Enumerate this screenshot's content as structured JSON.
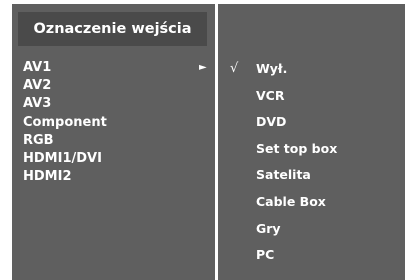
{
  "left_panel": {
    "title": "Oznaczenie wejścia",
    "inputs": [
      {
        "label": "AV1",
        "arrow": "►"
      },
      {
        "label": "AV2"
      },
      {
        "label": "AV3"
      },
      {
        "label": "Component"
      },
      {
        "label": "RGB"
      },
      {
        "label": "HDMI1/DVI"
      },
      {
        "label": "HDMI2"
      }
    ]
  },
  "right_panel": {
    "check_mark": "√",
    "options": [
      {
        "label": "Wył.",
        "selected": true
      },
      {
        "label": "VCR"
      },
      {
        "label": "DVD"
      },
      {
        "label": "Set top box"
      },
      {
        "label": "Satelita"
      },
      {
        "label": "Cable Box"
      },
      {
        "label": "Gry"
      },
      {
        "label": "PC"
      }
    ]
  },
  "colors": {
    "panel_bg": "#5f5f5f",
    "title_bg": "#4a4a4a",
    "text": "#ffffff"
  },
  "icons": {
    "submenu_arrow": "right-arrow-icon",
    "selection_check": "check-icon"
  }
}
